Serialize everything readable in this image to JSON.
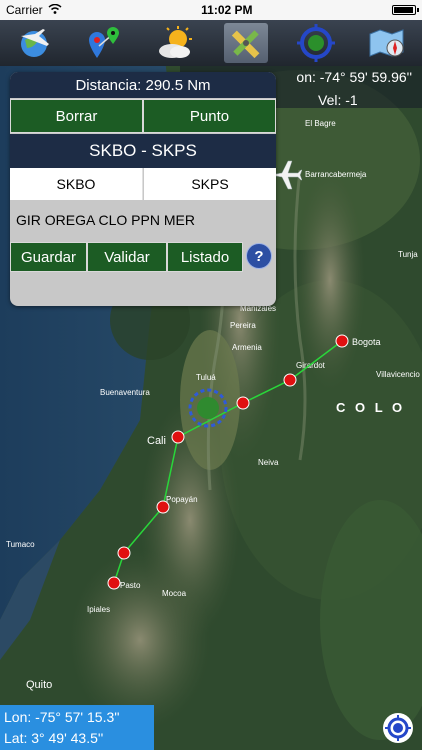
{
  "status_bar": {
    "carrier": "Carrier",
    "time": "11:02 PM",
    "battery_level": 0.95
  },
  "toolbar": {
    "buttons": [
      {
        "icon": "globe-plane-icon",
        "active": false
      },
      {
        "icon": "map-pins-icon",
        "active": false
      },
      {
        "icon": "weather-icon",
        "active": false
      },
      {
        "icon": "route-tools-icon",
        "active": true
      },
      {
        "icon": "crosshair-target-icon",
        "active": false
      },
      {
        "icon": "map-compass-icon",
        "active": false
      }
    ]
  },
  "coordinates_overlay": {
    "longitude": "on: -74° 59' 59.96''",
    "zero": "0",
    "velocity": "Vel: -1"
  },
  "route_panel": {
    "distance": "Distancia: 290.5 Nm",
    "delete_label": "Borrar",
    "point_label": "Punto",
    "route_title": "SKBO - SKPS",
    "origin": "SKBO",
    "destination": "SKPS",
    "route_text": "GIR OREGA CLO PPN MER",
    "save_label": "Guardar",
    "validate_label": "Validar",
    "list_label": "Listado",
    "help_label": "?"
  },
  "map": {
    "country_label": "C O L O",
    "cities": [
      {
        "name": "El Bagre"
      },
      {
        "name": "Barrancabermeja"
      },
      {
        "name": "Tunja"
      },
      {
        "name": "Manizales"
      },
      {
        "name": "Pereira"
      },
      {
        "name": "Armenia"
      },
      {
        "name": "Bogota"
      },
      {
        "name": "Girardot"
      },
      {
        "name": "Villavicencio"
      },
      {
        "name": "Buenaventura"
      },
      {
        "name": "Tuluá"
      },
      {
        "name": "Cali"
      },
      {
        "name": "Neiva"
      },
      {
        "name": "Popayán"
      },
      {
        "name": "Tumaco"
      },
      {
        "name": "Pasto"
      },
      {
        "name": "Ipiales"
      },
      {
        "name": "Mocoa"
      },
      {
        "name": "Quito"
      }
    ],
    "route_color": "#29d63a",
    "waypoint_color": "#e01010"
  },
  "bottom_coordinates": {
    "longitude": "Lon: -75° 57' 15.3''",
    "latitude": "Lat: 3° 49' 43.5''"
  }
}
